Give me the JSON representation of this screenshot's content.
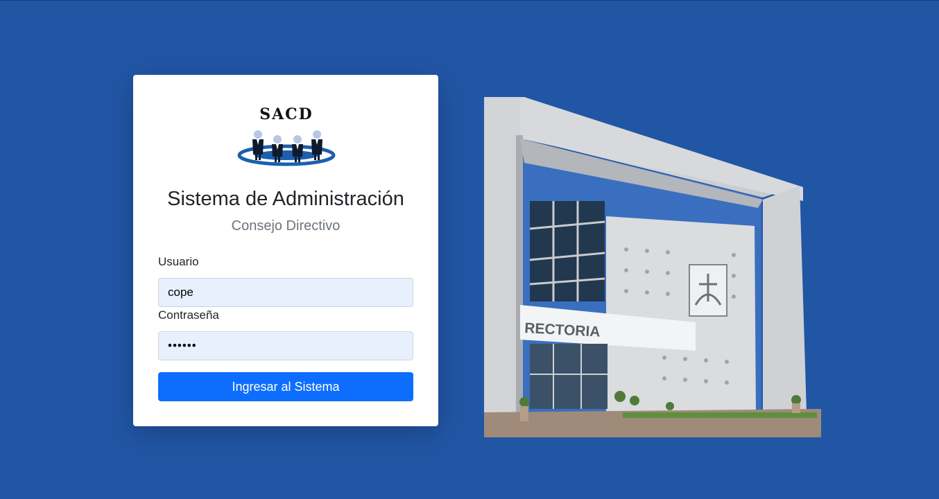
{
  "logo": {
    "text": "SACD"
  },
  "header": {
    "title": "Sistema de Administración",
    "subtitle": "Consejo Directivo"
  },
  "form": {
    "username_label": "Usuario",
    "username_value": "cope",
    "password_label": "Contraseña",
    "password_value": "cope12",
    "submit_label": "Ingresar al Sistema"
  },
  "photo": {
    "sign_text": "RECTORIA"
  },
  "colors": {
    "background": "#2156a5",
    "button": "#0d6efd",
    "input_autofill": "#e8f0fe"
  }
}
